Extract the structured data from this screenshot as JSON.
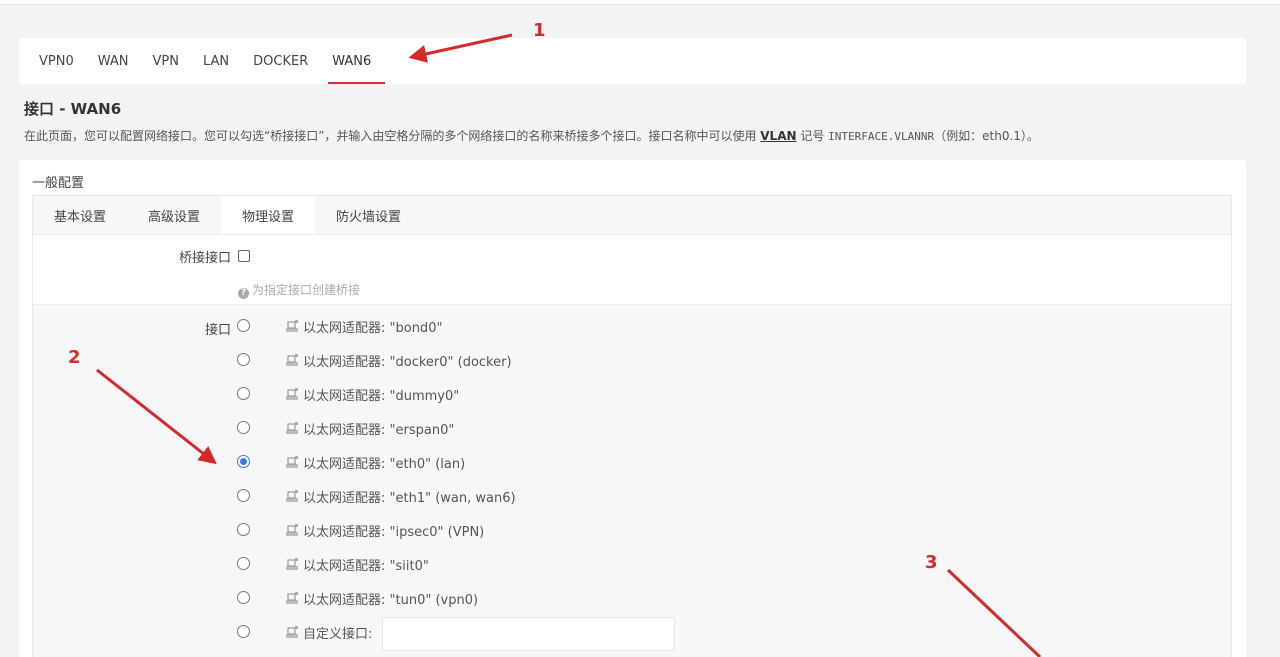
{
  "interface_tabs": [
    "VPN0",
    "WAN",
    "VPN",
    "LAN",
    "DOCKER",
    "WAN6"
  ],
  "active_interface_tab": "WAN6",
  "page": {
    "title": "接口 - WAN6",
    "desc_before": "在此页面，您可以配置网络接口。您可以勾选“桥接接口”，并输入由空格分隔的多个网络接口的名称来桥接多个接口。接口名称中可以使用 ",
    "desc_link": "VLAN",
    "desc_mid": " 记号 ",
    "desc_code": "INTERFACE.VLANNR",
    "desc_after": "（例如：eth0.1）。"
  },
  "section": {
    "title": "一般配置",
    "tabs": [
      "基本设置",
      "高级设置",
      "物理设置",
      "防火墙设置"
    ],
    "active_tab": "物理设置"
  },
  "bridge": {
    "label": "桥接接口",
    "checked": false,
    "hint": "为指定接口创建桥接"
  },
  "interface": {
    "label": "接口",
    "options": [
      {
        "text": "以太网适配器: \"bond0\"",
        "checked": false
      },
      {
        "text": "以太网适配器: \"docker0\" (docker)",
        "checked": false
      },
      {
        "text": "以太网适配器: \"dummy0\"",
        "checked": false
      },
      {
        "text": "以太网适配器: \"erspan0\"",
        "checked": false
      },
      {
        "text": "以太网适配器: \"eth0\" (lan)",
        "checked": true
      },
      {
        "text": "以太网适配器: \"eth1\" (wan, wan6)",
        "checked": false
      },
      {
        "text": "以太网适配器: \"ipsec0\" (VPN)",
        "checked": false
      },
      {
        "text": "以太网适配器: \"siit0\"",
        "checked": false
      },
      {
        "text": "以太网适配器: \"tun0\" (vpn0)",
        "checked": false
      }
    ],
    "custom_label": "自定义接口:",
    "custom_value": ""
  },
  "annotations": {
    "a1": "1",
    "a2": "2",
    "a3": "3",
    "color": "#d42a2a"
  }
}
